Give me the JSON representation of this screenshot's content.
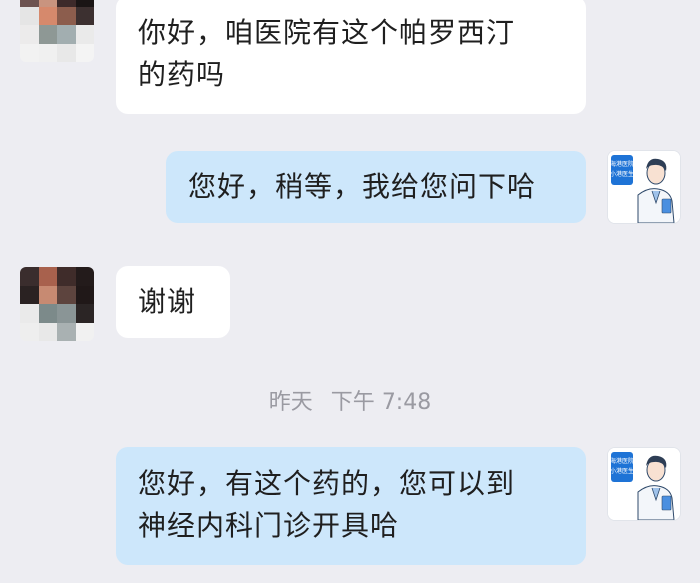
{
  "messages": [
    {
      "side": "left",
      "lines": [
        "你好，咱医院有这个帕罗西汀",
        "的药吗"
      ]
    },
    {
      "side": "right",
      "lines": [
        "您好，稍等，我给您问下哈"
      ]
    },
    {
      "side": "left",
      "lines": [
        "谢谢"
      ]
    },
    {
      "side": "right",
      "lines": [
        "您好，有这个药的，您可以到",
        "神经内科门诊开具哈"
      ]
    }
  ],
  "timestamp": {
    "day": "昨天",
    "period": "下午",
    "time": "7:48"
  },
  "doctor_avatar": {
    "line1": "海港医院",
    "line2": "小港医生",
    "accent": "#1e73d6"
  },
  "colors": {
    "background": "#ededf2",
    "left_bubble": "#ffffff",
    "right_bubble": "#cde7fb",
    "text": "#1f1f1f",
    "timestamp": "#9a9aa2"
  }
}
